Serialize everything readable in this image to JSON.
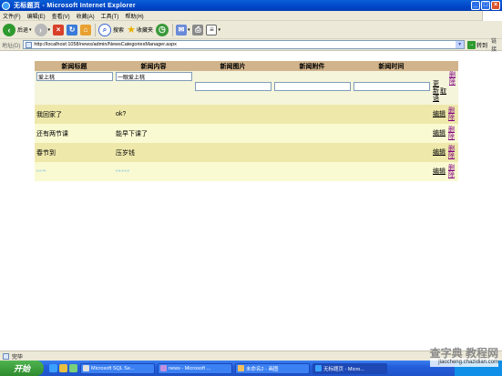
{
  "window": {
    "title": "无标题页 - Microsoft Internet Explorer"
  },
  "menu": {
    "items": [
      "文件(F)",
      "编辑(E)",
      "查看(V)",
      "收藏(A)",
      "工具(T)",
      "帮助(H)"
    ]
  },
  "toolbar": {
    "back": "后退",
    "search": "搜索",
    "favorites": "收藏夹"
  },
  "address": {
    "label": "地址(D)",
    "url": "http://localhost:1058/news/admin/NewsCategoriesManager.aspx",
    "go": "转到",
    "links": "链接"
  },
  "grid": {
    "headers": [
      "新闻标题",
      "新闻内容",
      "新闻图片",
      "新闻附件",
      "新闻时间"
    ],
    "edit_row": {
      "title_value": "爱上桃",
      "content_value": "一眼爱上桃",
      "update": [
        "更",
        "新",
        "语"
      ],
      "cancel": "取",
      "delete": [
        "删",
        "除"
      ]
    },
    "rows": [
      {
        "title": "我回家了",
        "content": "ok?",
        "edit": "编辑",
        "delete": [
          "删",
          "除"
        ]
      },
      {
        "title": "还有两节课",
        "content": "能早下课了",
        "edit": "编辑",
        "delete": [
          "删",
          "除"
        ]
      },
      {
        "title": "春节到",
        "content": "压岁钱",
        "edit": "编辑",
        "delete": [
          "删",
          "除"
        ]
      },
      {
        "title": "ꞏꞏ~",
        "content": "ꞏꞏꞏꞏꞏ",
        "edit": "编辑",
        "delete": [
          "删",
          "除"
        ]
      }
    ]
  },
  "status": {
    "text": "完毕"
  },
  "taskbar": {
    "start": "开始",
    "tasks": [
      "Microsoft SQL Se...",
      "news - Microsoft ...",
      "未命名2 - 画图",
      "无标题页 - Micro..."
    ]
  },
  "watermark": {
    "line1": "查字典 教程网",
    "line2": "jiaocheng.chazidian.com"
  },
  "colors": {
    "header": "#d2b48c",
    "edit_row": "#f5f5dc",
    "row_a": "#eee8aa",
    "row_b": "#fafad2"
  }
}
